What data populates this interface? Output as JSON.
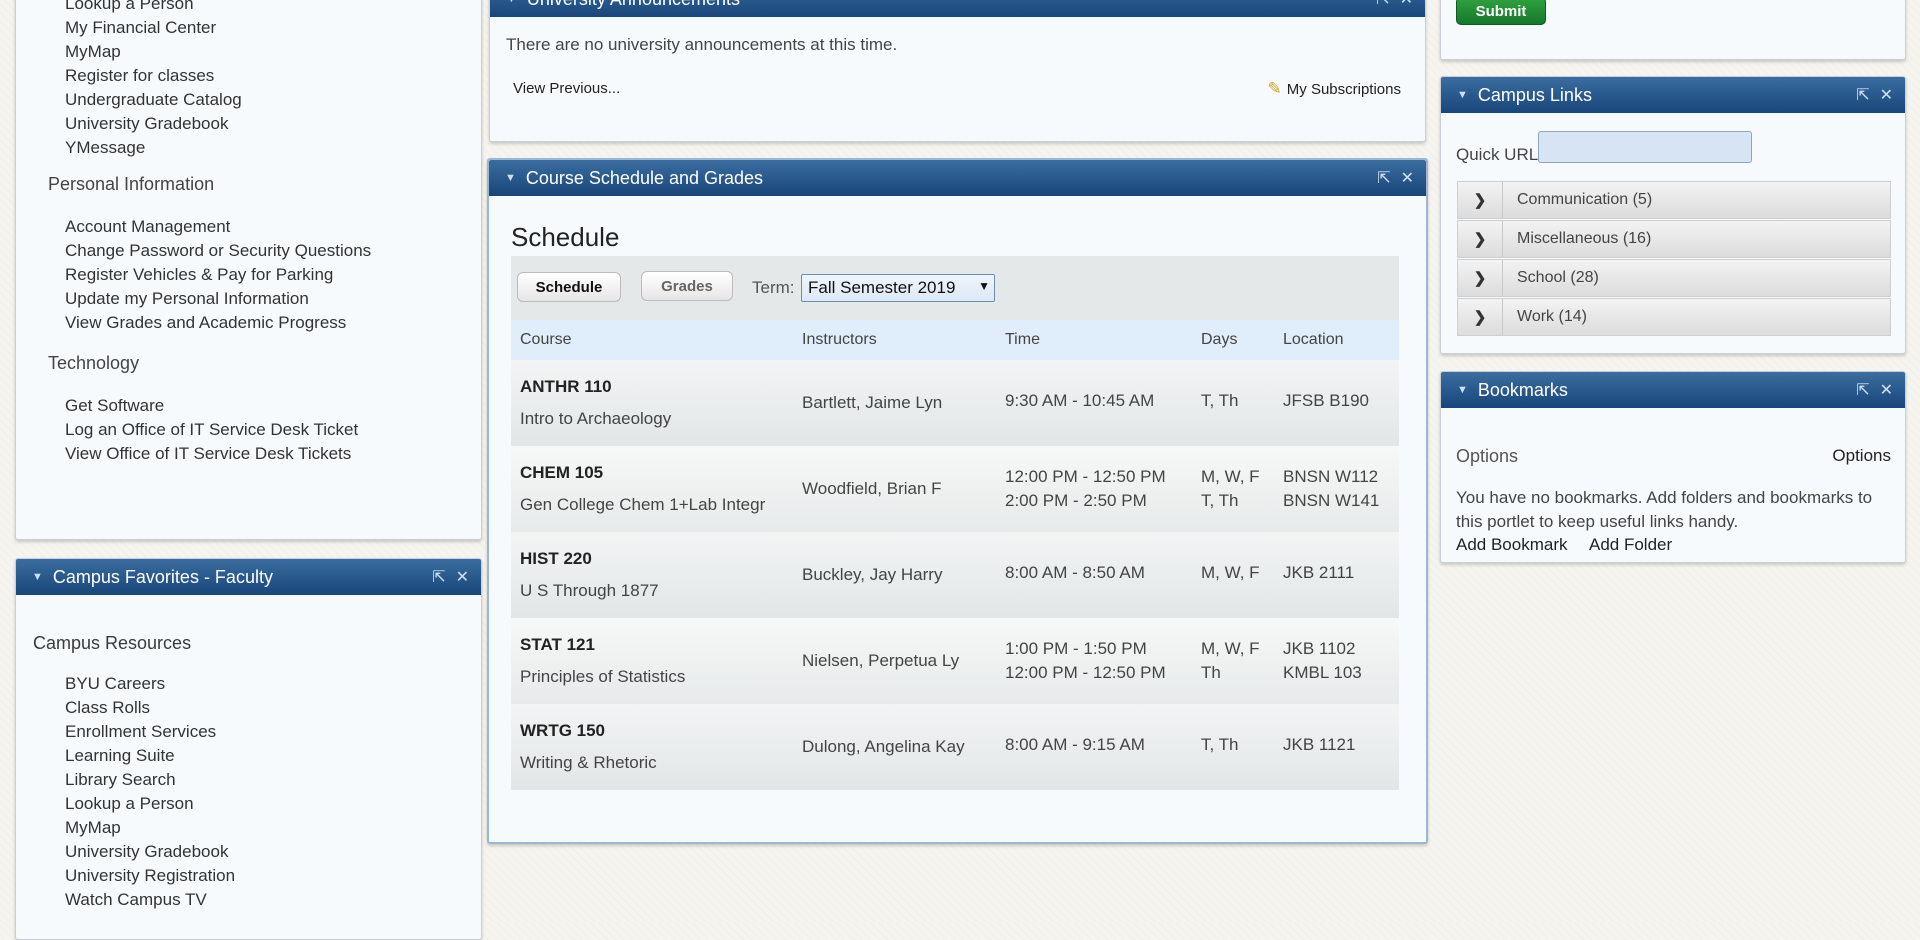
{
  "left_top": {
    "items_a": [
      "Lookup a Person",
      "My Financial Center",
      "MyMap",
      "Register for classes",
      "Undergraduate Catalog",
      "University Gradebook",
      "YMessage"
    ],
    "heading_personal": "Personal Information",
    "items_personal": [
      "Account Management",
      "Change Password or Security Questions",
      "Register Vehicles & Pay for Parking",
      "Update my Personal Information",
      "View Grades and Academic Progress"
    ],
    "heading_tech": "Technology",
    "items_tech": [
      "Get Software",
      "Log an Office of IT Service Desk Ticket",
      "View Office of IT Service Desk Tickets"
    ]
  },
  "favorites": {
    "title": "Campus Favorites - Faculty",
    "heading": "Campus Resources",
    "items": [
      "BYU Careers",
      "Class Rolls",
      "Enrollment Services",
      "Learning Suite",
      "Library Search",
      "Lookup a Person",
      "MyMap",
      "University Gradebook",
      "University Registration",
      "Watch Campus TV"
    ]
  },
  "announcements": {
    "title": "University Announcements",
    "message": "There are no university announcements at this time.",
    "view_previous": "View Previous...",
    "subscriptions": "My Subscriptions"
  },
  "schedule": {
    "title": "Course Schedule and Grades",
    "heading": "Schedule",
    "tab_schedule": "Schedule",
    "tab_grades": "Grades",
    "term_label": "Term:",
    "term_value": "Fall Semester 2019",
    "columns": [
      "Course",
      "Instructors",
      "Time",
      "Days",
      "Location"
    ],
    "rows": [
      {
        "code": "ANTHR 110",
        "name": "Intro to Archaeology",
        "instructor": "Bartlett, Jaime Lyn",
        "time1": "9:30 AM - 10:45 AM",
        "time2": "",
        "days1": "T, Th",
        "days2": "",
        "loc1": "JFSB B190",
        "loc2": ""
      },
      {
        "code": "CHEM 105",
        "name": "Gen College Chem 1+Lab Integr",
        "instructor": "Woodfield, Brian F",
        "time1": "12:00 PM - 12:50 PM",
        "time2": "2:00 PM - 2:50 PM",
        "days1": "M, W, F",
        "days2": "T, Th",
        "loc1": "BNSN W112",
        "loc2": "BNSN W141"
      },
      {
        "code": "HIST 220",
        "name": "U S Through 1877",
        "instructor": "Buckley, Jay Harry",
        "time1": "8:00 AM - 8:50 AM",
        "time2": "",
        "days1": "M, W, F",
        "days2": "",
        "loc1": "JKB 2111",
        "loc2": ""
      },
      {
        "code": "STAT 121",
        "name": "Principles of Statistics",
        "instructor": "Nielsen, Perpetua Ly",
        "time1": "1:00 PM - 1:50 PM",
        "time2": "12:00 PM - 12:50 PM",
        "days1": "M, W, F",
        "days2": "Th",
        "loc1": "JKB 1102",
        "loc2": "KMBL 103"
      },
      {
        "code": "WRTG 150",
        "name": "Writing & Rhetoric",
        "instructor": "Dulong, Angelina Kay",
        "time1": "8:00 AM - 9:15 AM",
        "time2": "",
        "days1": "T, Th",
        "days2": "",
        "loc1": "JKB 1121",
        "loc2": ""
      }
    ]
  },
  "submit_label": "Submit",
  "campus_links": {
    "title": "Campus Links",
    "quick_url_label": "Quick URL",
    "quick_url_value": "",
    "categories": [
      "Communication (5)",
      "Miscellaneous (16)",
      "School (28)",
      "Work (14)"
    ]
  },
  "bookmarks": {
    "title": "Bookmarks",
    "options_left": "Options",
    "options_right": "Options",
    "message": "You have no bookmarks. Add folders and bookmarks to this portlet to keep useful links handy.",
    "add_bookmark": "Add Bookmark",
    "add_folder": "Add Folder"
  },
  "icons": {
    "collapse": "triangle-down-icon",
    "popout": "popout-icon",
    "close": "close-icon",
    "pencil": "pencil-icon",
    "chevron": "chevron-right-icon"
  },
  "colors": {
    "header_blue": "#1f4f84",
    "submit_green": "#1e8a2e",
    "table_header": "#e0eefb"
  }
}
